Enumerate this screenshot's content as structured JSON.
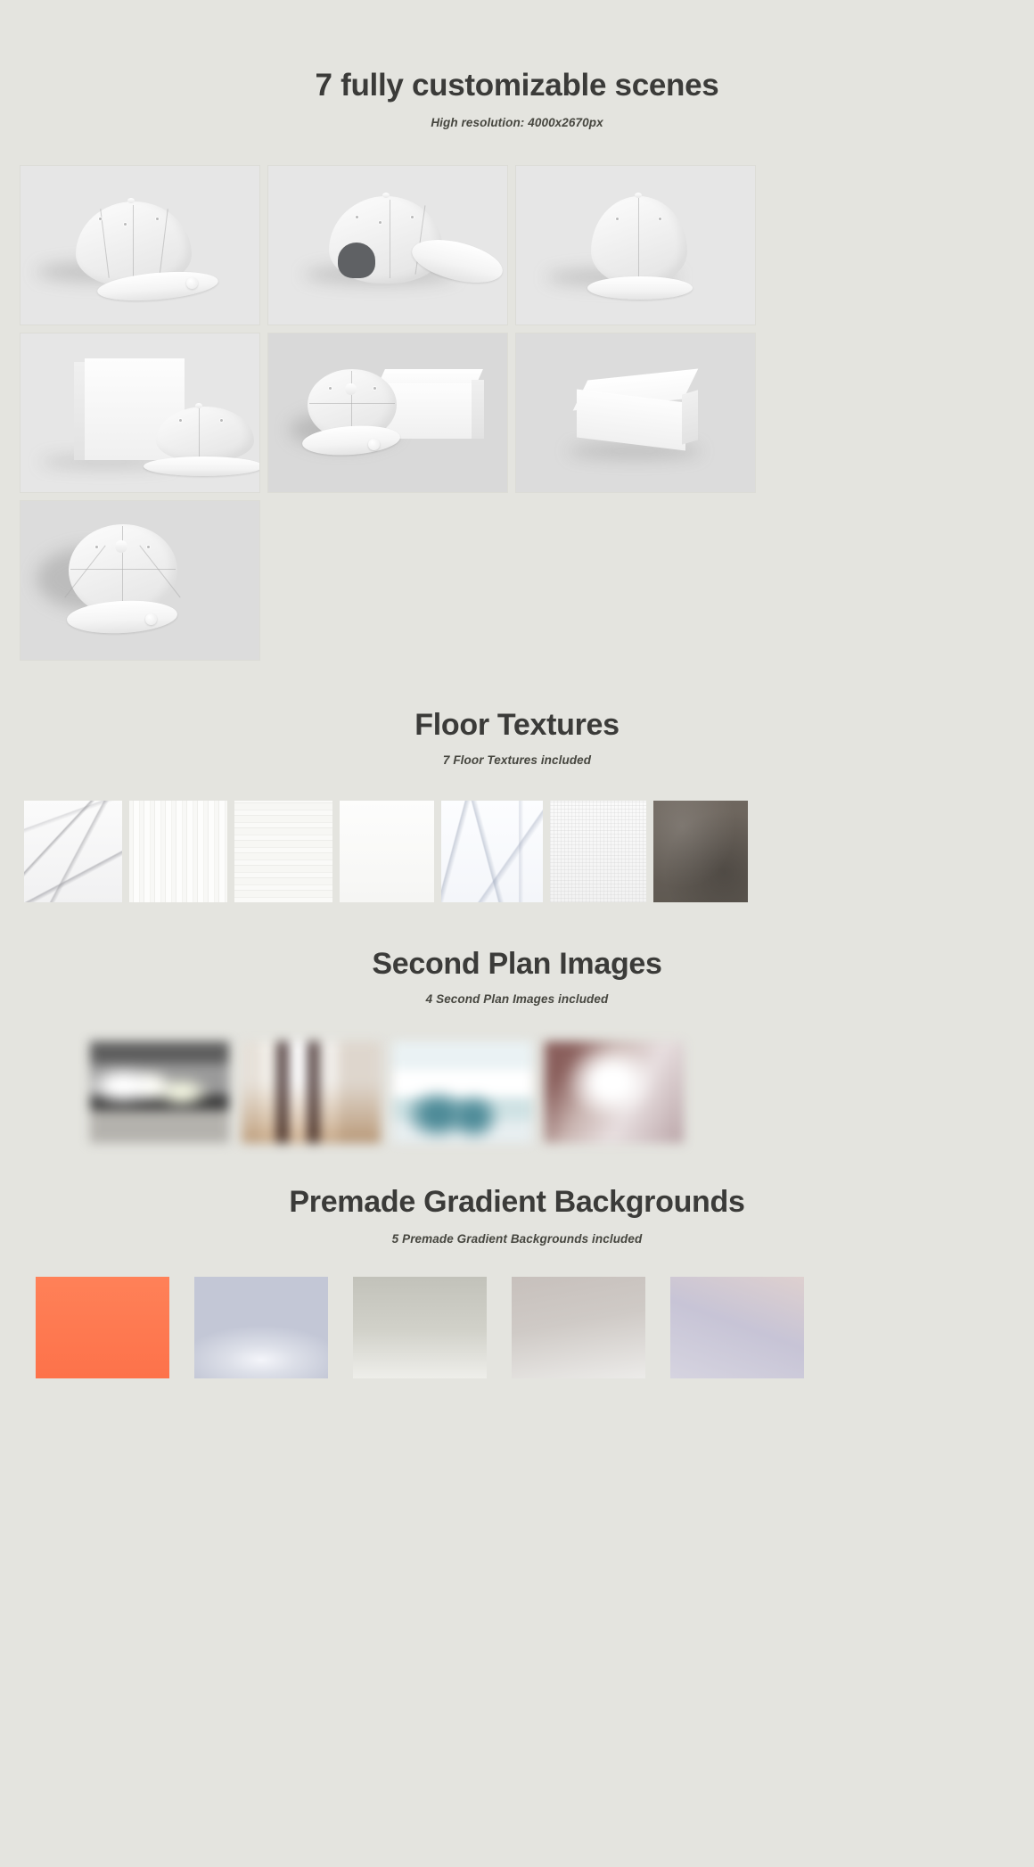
{
  "page": {
    "background_color": "#e4e4df",
    "text_color": "#3b3b39"
  },
  "hero": {
    "title": "7 fully customizable scenes",
    "subtitle": "High resolution: 4000x2670px"
  },
  "scenes": {
    "count": 7,
    "items": [
      {
        "name": "cap-front-three-quarter-view",
        "caption": ""
      },
      {
        "name": "cap-back-view-open-snapback",
        "caption": ""
      },
      {
        "name": "cap-front-view",
        "caption": ""
      },
      {
        "name": "cap-with-standing-box",
        "caption": ""
      },
      {
        "name": "cap-top-view-with-box",
        "caption": ""
      },
      {
        "name": "box-only-angled",
        "caption": ""
      },
      {
        "name": "cap-top-angled-view",
        "caption": ""
      }
    ]
  },
  "floor_textures": {
    "title": "Floor Textures",
    "subtitle": "7 Floor Textures included",
    "count": 7,
    "items": [
      {
        "name": "white-marble",
        "color": "#f4f4f4"
      },
      {
        "name": "white-vertical-wood",
        "color": "#f7f7f5"
      },
      {
        "name": "white-horizontal-wood",
        "color": "#f6f6f4"
      },
      {
        "name": "plain-white",
        "color": "#fbfbfa"
      },
      {
        "name": "cool-white-marble",
        "color": "#fafbfd"
      },
      {
        "name": "light-concrete",
        "color": "#f4f4f2"
      },
      {
        "name": "dark-brown-concrete",
        "color": "#6d655e"
      }
    ]
  },
  "second_plan_images": {
    "title": "Second Plan Images",
    "subtitle": "4 Second Plan Images included",
    "count": 4,
    "items": [
      {
        "name": "blurred-grey-interior",
        "color": "#8e8f8e"
      },
      {
        "name": "blurred-warm-room-windows",
        "color": "#c6b6a9"
      },
      {
        "name": "blurred-teal-office",
        "color": "#cfe0e2"
      },
      {
        "name": "blurred-mauve-interior",
        "color": "#b5a0a2"
      }
    ]
  },
  "gradients": {
    "title": "Premade Gradient Backgrounds",
    "subtitle": "5 Premade Gradient Backgrounds included",
    "count": 5,
    "items": [
      {
        "name": "coral-orange",
        "color": "#ff7a51"
      },
      {
        "name": "cool-grey-spotlight",
        "color": "#c8ccd8"
      },
      {
        "name": "warm-grey-fade",
        "color": "#c3c3bb"
      },
      {
        "name": "beige-grey-fade",
        "color": "#c8c1bd"
      },
      {
        "name": "lilac-blush-fade",
        "color": "#c5c2d3"
      }
    ]
  }
}
